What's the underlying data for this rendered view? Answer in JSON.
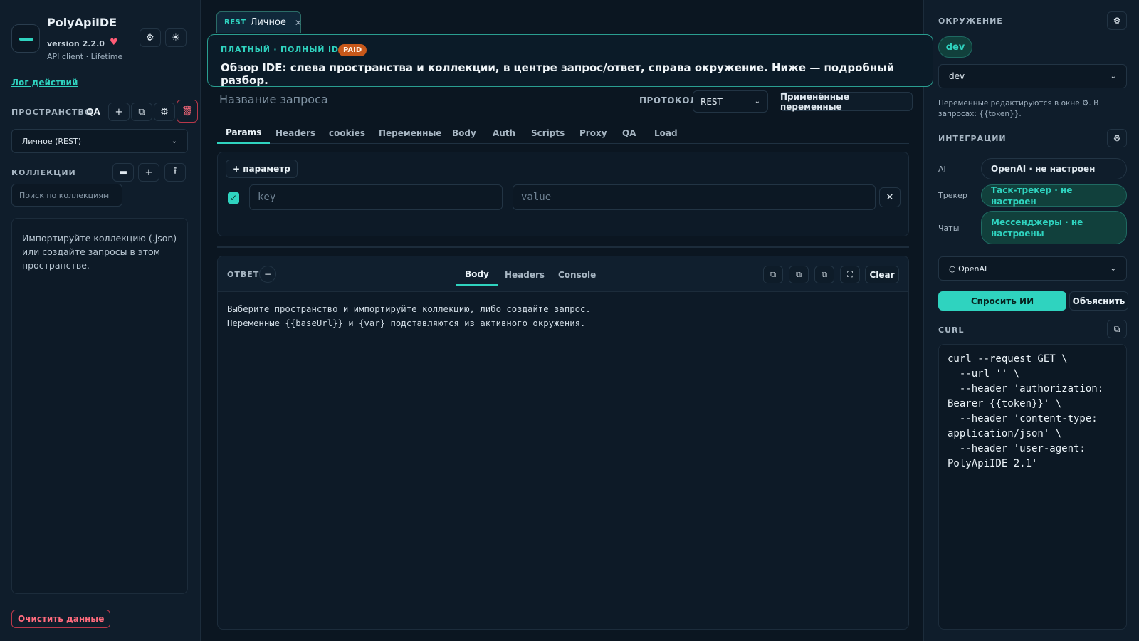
{
  "app": {
    "title": "PolyApiIDE",
    "version": "version 2.2.0",
    "subtitle": "API client · Lifetime",
    "accent": "#2fd3bf",
    "danger": "#ff6b7d"
  },
  "sidebar": {
    "log_link": "Лог действий",
    "spaces_heading": "ПРОСТРАНСТВО",
    "space_tag": "QA",
    "space_select": "Личное (REST)",
    "collections_heading": "КОЛЛЕКЦИИ",
    "search_placeholder": "Поиск по коллекциям",
    "empty_text": "Импортируйте коллекцию (.json) или создайте запросы в этом пространстве.",
    "clear_data": "Очистить данные"
  },
  "request_tab": {
    "protocol": "REST",
    "name": "Личное"
  },
  "banner": {
    "kicker": "ПЛАТНЫЙ · ПОЛНЫЙ IDE",
    "badge": "PAID",
    "text": "Обзор IDE: слева пространства и коллекции, в центре запрос/ответ, справа окружение. Ниже — подробный разбор."
  },
  "request": {
    "name_placeholder": "Название запроса",
    "protocol_label": "ПРОТОКОЛ",
    "protocol_value": "REST",
    "applied_vars": "Применённые переменные",
    "tabs": [
      "Params",
      "Headers",
      "cookies",
      "Переменные",
      "Body",
      "Auth",
      "Scripts",
      "Proxy",
      "QA",
      "Load"
    ],
    "active_tab": "Params",
    "add_param": "+ параметр",
    "key_placeholder": "key",
    "value_placeholder": "value"
  },
  "response": {
    "label": "ОТВЕТ",
    "tabs": [
      "Body",
      "Headers",
      "Console"
    ],
    "clear": "Clear",
    "body_line1": "Выберите пространство и импортируйте коллекцию, либо создайте запрос.",
    "body_line2": "Переменные {{baseUrl}} и {var} подставляются из активного окружения."
  },
  "environment": {
    "heading": "ОКРУЖЕНИЕ",
    "chip": "dev",
    "select": "dev",
    "note": "Переменные редактируются в окне ⚙. В запросах: {{token}}."
  },
  "integrations": {
    "heading": "ИНТЕГРАЦИИ",
    "items": [
      {
        "label": "AI",
        "value": "OpenAI · не настроен"
      },
      {
        "label": "Трекер",
        "value": "Таск-трекер · не настроен"
      },
      {
        "label": "Чаты",
        "value": "Мессенджеры · не настроены"
      }
    ],
    "model_select": "○ OpenAI",
    "ask": "Спросить ИИ",
    "explain": "Объяснить"
  },
  "curl": {
    "heading": "CURL",
    "code": "curl --request GET \\\n  --url '' \\\n  --header 'authorization: Bearer {{token}}' \\\n  --header 'content-type: application/json' \\\n  --header 'user-agent: PolyApiIDE 2.1'"
  }
}
